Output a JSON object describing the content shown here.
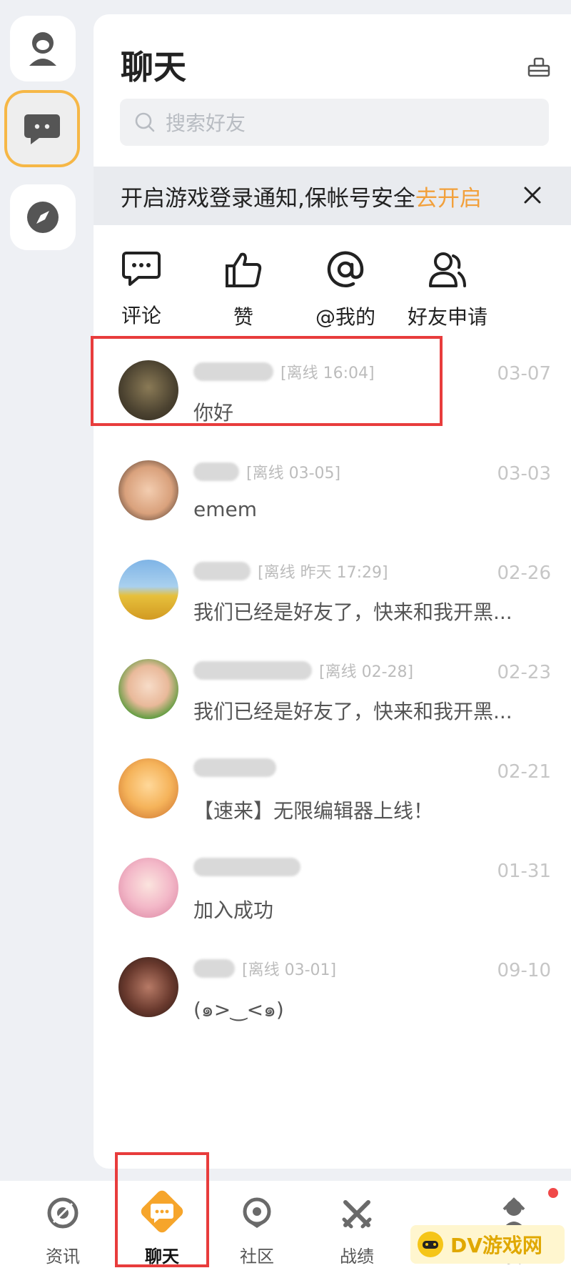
{
  "app": {
    "accent": "#f6b746",
    "highlight": "#e83c3c"
  },
  "header": {
    "title": "聊天"
  },
  "search": {
    "placeholder": "搜索好友"
  },
  "notice": {
    "text": "开启游戏登录通知,保帐号安全",
    "link": "去开启"
  },
  "quick_actions": [
    {
      "label": "评论",
      "icon": "comment-icon"
    },
    {
      "label": "赞",
      "icon": "thumbs-up-icon"
    },
    {
      "label": "@我的",
      "icon": "at-icon"
    },
    {
      "label": "好友申请",
      "icon": "friend-request-icon"
    }
  ],
  "chats": [
    {
      "status": "[离线 16:04]",
      "date": "03-07",
      "preview": "你好"
    },
    {
      "status": "[离线 03-05]",
      "date": "03-03",
      "preview": "emem"
    },
    {
      "status": "[离线 昨天 17:29]",
      "date": "02-26",
      "preview": "我们已经是好友了，快来和我开黑..."
    },
    {
      "status": "[离线 02-28]",
      "date": "02-23",
      "preview": "我们已经是好友了，快来和我开黑..."
    },
    {
      "status": "",
      "date": "02-21",
      "preview": "【速来】无限编辑器上线！"
    },
    {
      "status": "",
      "date": "01-31",
      "preview": "加入成功"
    },
    {
      "status": "[离线 03-01]",
      "date": "09-10",
      "preview": "(๑>‿<๑)"
    }
  ],
  "bottom_nav": [
    {
      "label": "资讯",
      "icon": "news-icon"
    },
    {
      "label": "聊天",
      "icon": "chat-icon"
    },
    {
      "label": "社区",
      "icon": "community-icon"
    },
    {
      "label": "战绩",
      "icon": "battle-record-icon"
    },
    {
      "label": "我",
      "icon": "profile-icon"
    }
  ],
  "watermark": {
    "text": "DV游戏网"
  }
}
